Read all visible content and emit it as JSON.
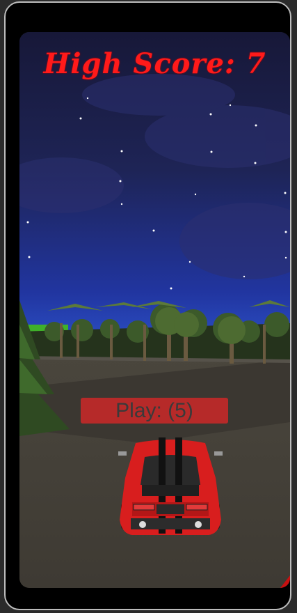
{
  "game": {
    "high_score_label": "High Score: 7",
    "play_label": "Play: (5)"
  },
  "colors": {
    "sky_top": "#1b1d4a",
    "sky_horizon": "#1f3aa8",
    "road": "#4a473f",
    "grass": "#3f3a33",
    "car": "#d81e1e",
    "score_text": "#ff1a1a",
    "play_button": "#cd2828"
  }
}
